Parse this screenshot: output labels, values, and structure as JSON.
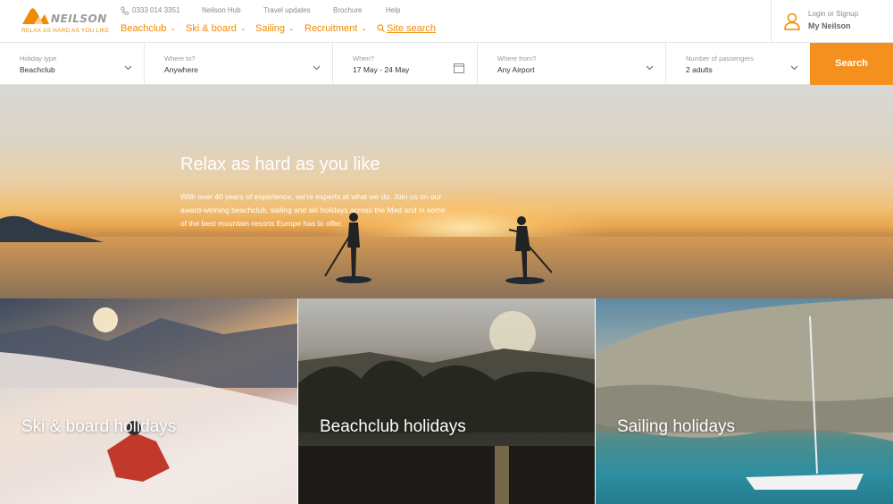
{
  "brand": {
    "name": "NEILSON",
    "tagline": "RELAX AS HARD AS YOU LIKE",
    "accent": "#f08a00",
    "button_color": "#f5901e"
  },
  "header": {
    "phone": "0333 014 3351",
    "top_links": [
      "Neilson Hub",
      "Travel updates",
      "Brochure",
      "Help"
    ],
    "nav": [
      "Beachclub",
      "Ski & board",
      "Sailing",
      "Recruitment"
    ],
    "site_search": "Site search",
    "account": {
      "login": "Login or Signup",
      "my": "My Neilson"
    }
  },
  "search": {
    "holiday_type": {
      "label": "Holiday type",
      "value": "Beachclub"
    },
    "where_to": {
      "label": "Where to?",
      "value": "Anywhere"
    },
    "when": {
      "label": "When?",
      "value": "17 May - 24 May"
    },
    "where_from": {
      "label": "Where from?",
      "value": "Any Airport"
    },
    "passengers": {
      "label": "Number of passengers",
      "value": "2 adults"
    },
    "button": "Search"
  },
  "hero": {
    "title": "Relax as hard as you like",
    "text": "With over 40 years of experience, we're experts at what we do. Join us on our award-winning beachclub, sailing and ski holidays across the Med and in some of the best mountain resorts Europe has to offer."
  },
  "tiles": [
    {
      "title": "Ski & board holidays"
    },
    {
      "title": "Beachclub holidays"
    },
    {
      "title": "Sailing holidays"
    }
  ]
}
